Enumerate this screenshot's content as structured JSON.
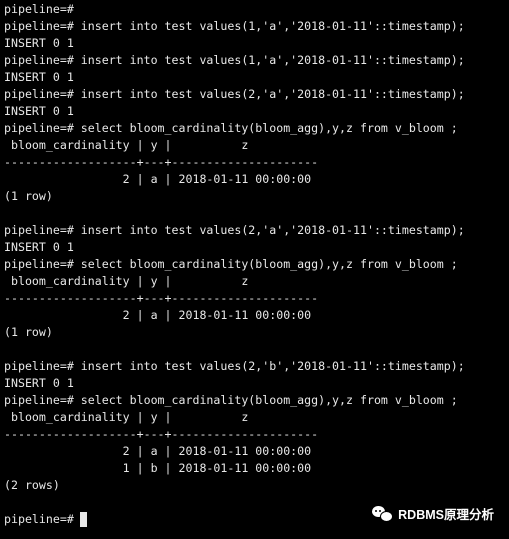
{
  "terminal": {
    "lines": [
      "pipeline=#",
      "pipeline=# insert into test values(1,'a','2018-01-11'::timestamp);",
      "INSERT 0 1",
      "pipeline=# insert into test values(1,'a','2018-01-11'::timestamp);",
      "INSERT 0 1",
      "pipeline=# insert into test values(2,'a','2018-01-11'::timestamp);",
      "INSERT 0 1",
      "pipeline=# select bloom_cardinality(bloom_agg),y,z from v_bloom ;",
      " bloom_cardinality | y |          z",
      "-------------------+---+---------------------",
      "                 2 | a | 2018-01-11 00:00:00",
      "(1 row)",
      "",
      "pipeline=# insert into test values(2,'a','2018-01-11'::timestamp);",
      "INSERT 0 1",
      "pipeline=# select bloom_cardinality(bloom_agg),y,z from v_bloom ;",
      " bloom_cardinality | y |          z",
      "-------------------+---+---------------------",
      "                 2 | a | 2018-01-11 00:00:00",
      "(1 row)",
      "",
      "pipeline=# insert into test values(2,'b','2018-01-11'::timestamp);",
      "INSERT 0 1",
      "pipeline=# select bloom_cardinality(bloom_agg),y,z from v_bloom ;",
      " bloom_cardinality | y |          z",
      "-------------------+---+---------------------",
      "                 2 | a | 2018-01-11 00:00:00",
      "                 1 | b | 2018-01-11 00:00:00",
      "(2 rows)",
      ""
    ],
    "prompt": "pipeline=#"
  },
  "watermark": {
    "text": "RDBMS原理分析",
    "icon": "wechat-icon"
  },
  "colors": {
    "background": "#000000",
    "text": "#e8e8e8"
  }
}
